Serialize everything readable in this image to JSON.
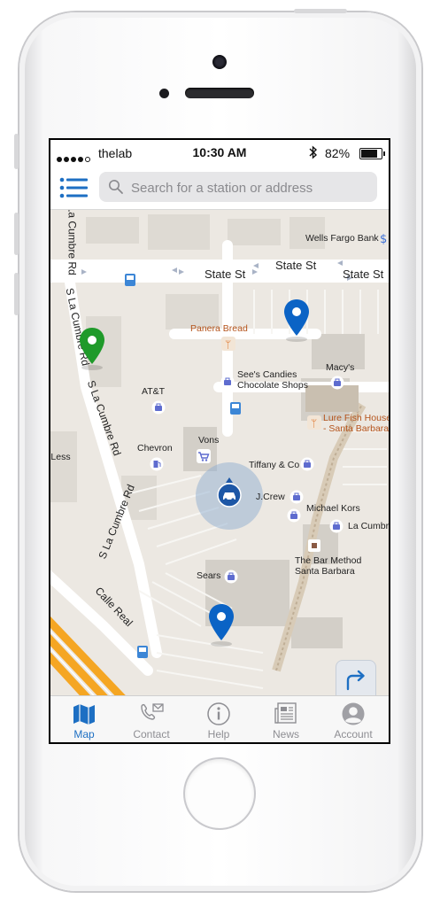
{
  "status_bar": {
    "carrier": "thelab",
    "time": "10:30 AM",
    "battery": "82%"
  },
  "search": {
    "placeholder": "Search for a station or address"
  },
  "map": {
    "streets": {
      "state_st_1": "State St",
      "state_st_2": "State St",
      "state_st_3": "State St",
      "la_cumbre_1": "S La Cumbre Rd",
      "la_cumbre_2": "S La Cumbre Rd",
      "la_cumbre_3": "S La Cumbre Rd",
      "la_cumbre_4": "S La Cumbre Rd",
      "calle_real": "Calle Real"
    },
    "places": {
      "wells_fargo": "Wells Fargo Bank",
      "panera": "Panera Bread",
      "sees_1": "See's Candies",
      "sees_2": "Chocolate Shops",
      "macys": "Macy's",
      "att": "AT&T",
      "lure_1": "Lure Fish House",
      "lure_2": "- Santa Barbara",
      "chevron": "Chevron",
      "vons": "Vons",
      "tiffany": "Tiffany & Co",
      "jcrew": "J.Crew",
      "michael_kors": "Michael Kors",
      "la_cumbre_place": "La Cumbre",
      "bar_method_1": "The Bar Method",
      "bar_method_2": "Santa Barbara",
      "sears": "Sears",
      "less": "r Less"
    },
    "colors": {
      "pin_blue": "#0b63c5",
      "pin_green": "#1f9a2a",
      "freeway": "#f5a623",
      "accent": "#1d6fc3"
    }
  },
  "map_controls": {
    "directions_icon": "turn-right-arrow-icon",
    "locate_icon": "crosshair-icon"
  },
  "tabs": [
    {
      "label": "Map",
      "icon": "map-icon",
      "active": true
    },
    {
      "label": "Contact",
      "icon": "phone-mail-icon",
      "active": false
    },
    {
      "label": "Help",
      "icon": "info-icon",
      "active": false
    },
    {
      "label": "News",
      "icon": "news-icon",
      "active": false
    },
    {
      "label": "Account",
      "icon": "account-icon",
      "active": false
    }
  ]
}
